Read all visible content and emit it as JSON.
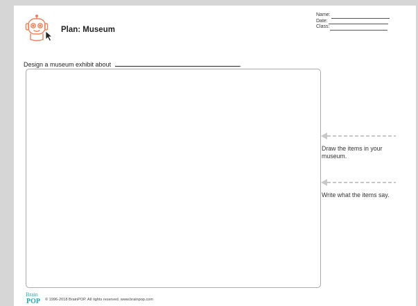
{
  "header": {
    "title": "Plan: Museum",
    "logo_icon": "robot-moby-icon",
    "name_label": "Name:",
    "date_label": "Date:",
    "class_label": "Class:"
  },
  "prompt": {
    "text": "Design a museum exhibit about",
    "end": "."
  },
  "instructions": {
    "draw": "Draw the items in your museum.",
    "write": "Write what the items say."
  },
  "footer": {
    "brand_logo": "BrainPOP",
    "copyright": "© 1996-2018 BrainPOP. All rights reserved. www.brainpop.com"
  },
  "colors": {
    "accent": "#f0805a",
    "background": "#d6d6d6",
    "arrow": "#c8c8c8",
    "brand_teal": "#2aa9b3"
  }
}
